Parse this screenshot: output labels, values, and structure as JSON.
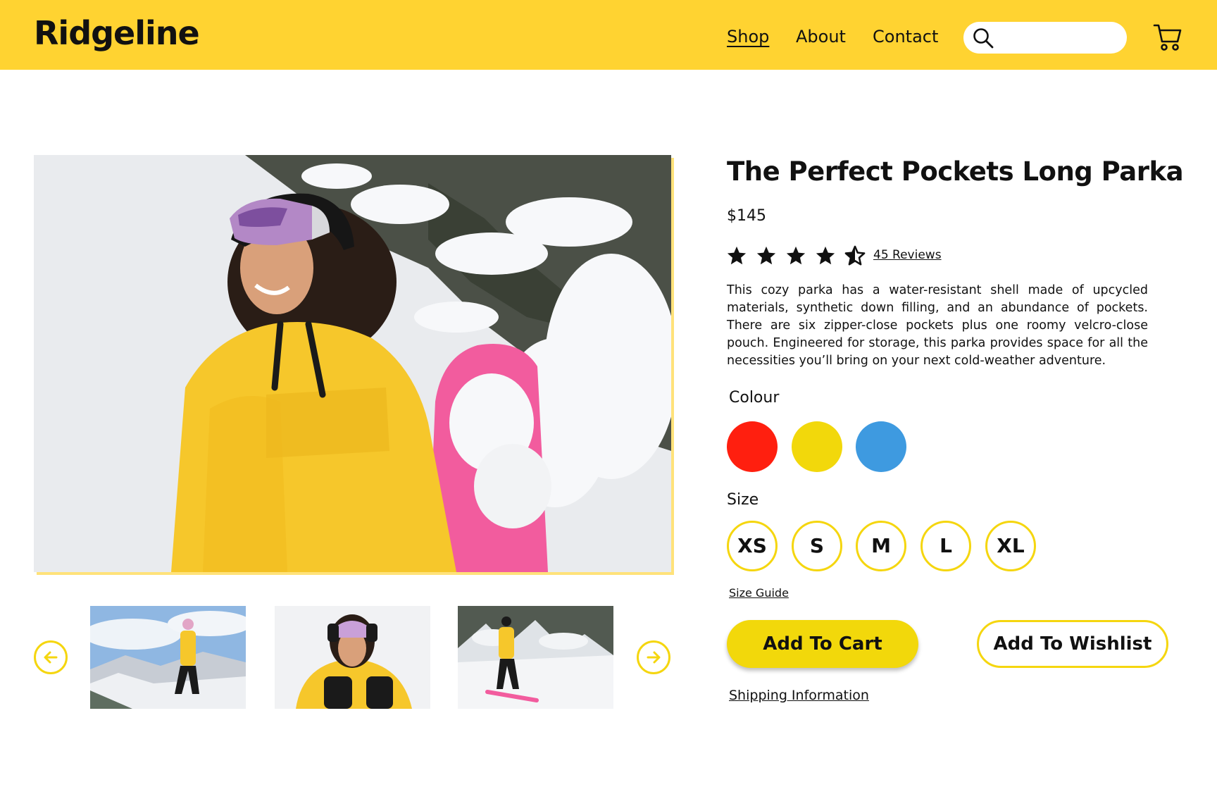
{
  "header": {
    "logo": "Ridgeline",
    "nav": [
      "Shop",
      "About",
      "Contact"
    ],
    "search_placeholder": "",
    "icons": {
      "search": "search-icon",
      "cart": "cart-icon"
    }
  },
  "product": {
    "title": "The Perfect Pockets Long Parka",
    "price": "$145",
    "rating": 4.5,
    "rating_max": 5,
    "reviews": "45 Reviews",
    "description": "This cozy parka has a water-resistant shell made of upcycled materials, synthetic down filling, and an abundance of pockets. There are six zipper-close pockets plus one roomy velcro-close pouch. Engineered for storage, this parka provides space for all the necessities you’ll bring on your next cold-weather adventure.",
    "colour_label": "Colour",
    "colours": [
      "#FF1F0F",
      "#F2D80B",
      "#3E9AE0"
    ],
    "size_label": "Size",
    "sizes": [
      "XS",
      "S",
      "M",
      "L",
      "XL"
    ],
    "size_guide": "Size Guide",
    "add_to_cart": "Add To Cart",
    "add_to_wishlist": "Add To Wishlist",
    "shipping_info": "Shipping Information"
  },
  "colors": {
    "brand_yellow": "#FFD331",
    "accent_yellow": "#F5D60F"
  }
}
